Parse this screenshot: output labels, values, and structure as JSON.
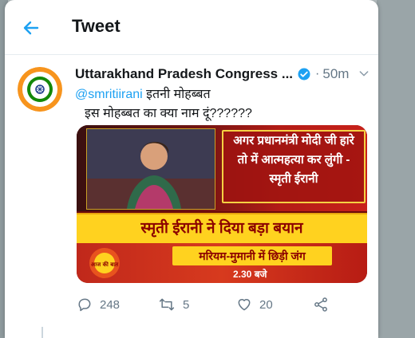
{
  "header": {
    "title": "Tweet",
    "back_icon": "arrow-left-icon"
  },
  "tweet": {
    "author_name": "Uttarakhand Pradesh Congress ...",
    "verified_icon": "verified-badge-icon",
    "separator": "·",
    "time": "50m",
    "menu_icon": "chevron-down-icon",
    "mention": "@smritiirani",
    "line1_text": " इतनी मोहब्बत",
    "line2_text": "इस मोहब्बत का क्या नाम दूं??????",
    "avatar_text": "CONGRESS SEWA DAL",
    "media": {
      "quote_line1": "अगर प्रधानमंत्री मोदी जी हारे",
      "quote_line2": "तो में आत्महत्या कर लुंगी -",
      "quote_line3": "स्मृती ईरानी",
      "headline": "स्मृती ईरानी ने दिया  बड़ा बयान",
      "subheadline": "मरियम-मुमानी में छिड़ी जंग",
      "show_time": "2.30 बजे",
      "logo_text": "आज की बात"
    }
  },
  "actions": {
    "reply_count": "248",
    "retweet_count": "5",
    "like_count": "20",
    "reply_icon": "reply-icon",
    "retweet_icon": "retweet-icon",
    "like_icon": "heart-icon",
    "share_icon": "share-icon"
  },
  "colors": {
    "accent": "#1da1f2",
    "text": "#14171a",
    "muted": "#657786"
  }
}
